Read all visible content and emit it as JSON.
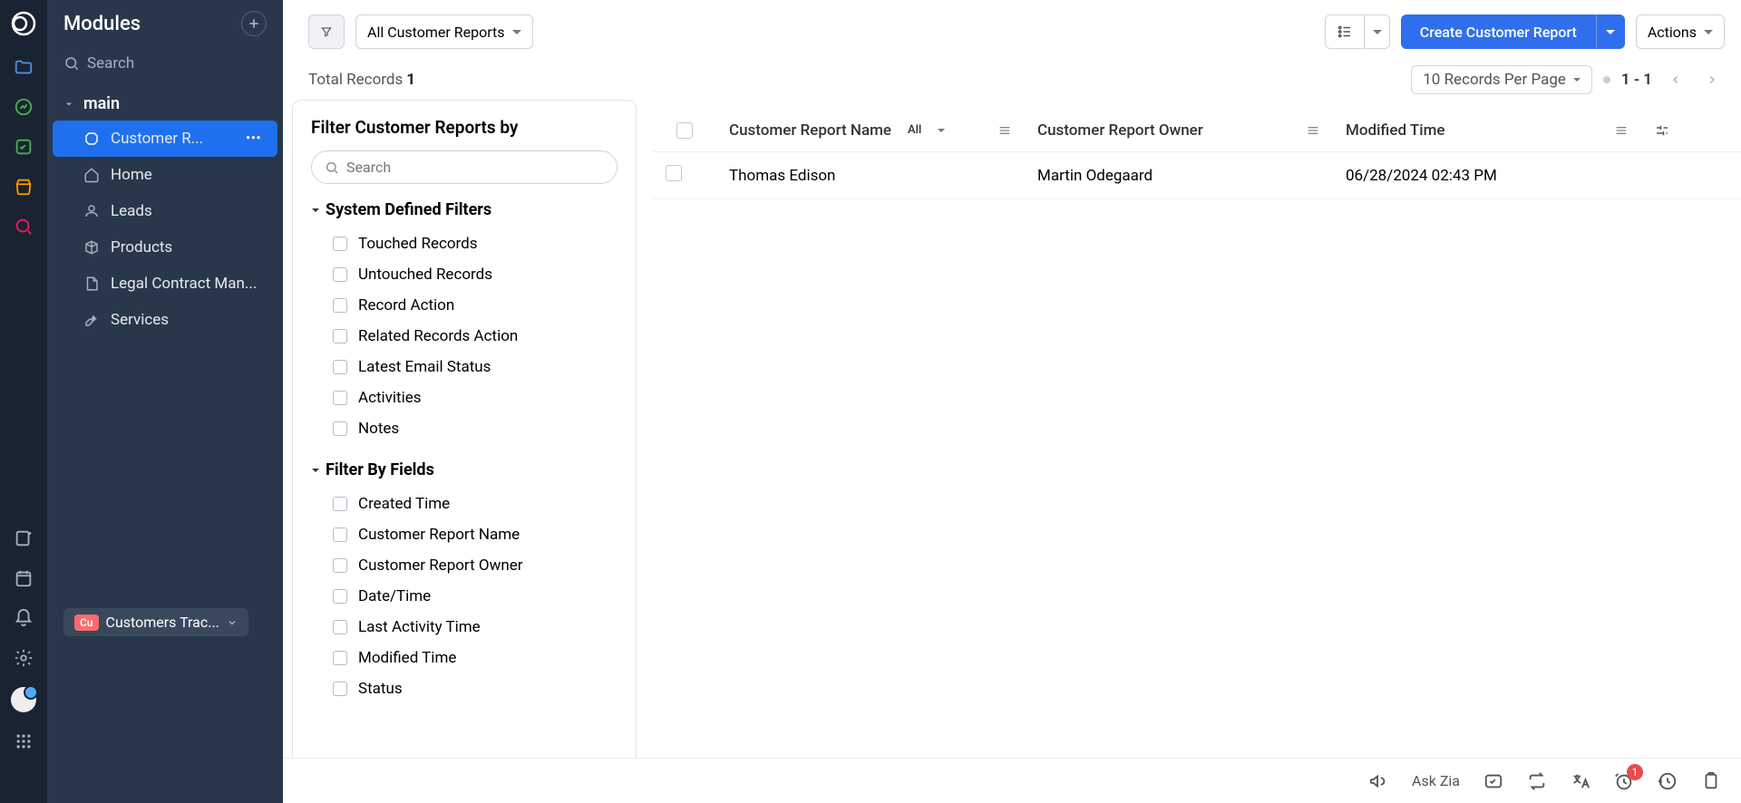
{
  "modules": {
    "title": "Modules",
    "search_placeholder": "Search",
    "group": "main",
    "items": [
      {
        "label": "Customer R...",
        "active": true,
        "icon": "customer"
      },
      {
        "label": "Home",
        "icon": "home"
      },
      {
        "label": "Leads",
        "icon": "leads"
      },
      {
        "label": "Products",
        "icon": "products"
      },
      {
        "label": "Legal Contract Man...",
        "icon": "legal"
      },
      {
        "label": "Services",
        "icon": "services"
      }
    ],
    "workspace": {
      "badge": "Cu",
      "label": "Customers Trac..."
    }
  },
  "toolbar": {
    "view_dropdown": "All Customer Reports",
    "create_label": "Create Customer Report",
    "actions_label": "Actions"
  },
  "records": {
    "total_label": "Total Records",
    "total_count": "1",
    "per_page": "10 Records Per Page",
    "range": "1 - 1"
  },
  "filter": {
    "title": "Filter Customer Reports by",
    "search_placeholder": "Search",
    "system": {
      "title": "System Defined Filters",
      "items": [
        "Touched Records",
        "Untouched Records",
        "Record Action",
        "Related Records Action",
        "Latest Email Status",
        "Activities",
        "Notes"
      ]
    },
    "fields": {
      "title": "Filter By Fields",
      "items": [
        "Created Time",
        "Customer Report Name",
        "Customer Report Owner",
        "Date/Time",
        "Last Activity Time",
        "Modified Time",
        "Status"
      ]
    }
  },
  "table": {
    "headers": {
      "name": "Customer Report Name",
      "name_chip": "All",
      "owner": "Customer Report Owner",
      "time": "Modified Time"
    },
    "row": {
      "name": "Thomas Edison",
      "owner": "Martin Odegaard",
      "time": "06/28/2024 02:43 PM"
    }
  },
  "bottom": {
    "ask": "Ask Zia",
    "badge": "1"
  }
}
